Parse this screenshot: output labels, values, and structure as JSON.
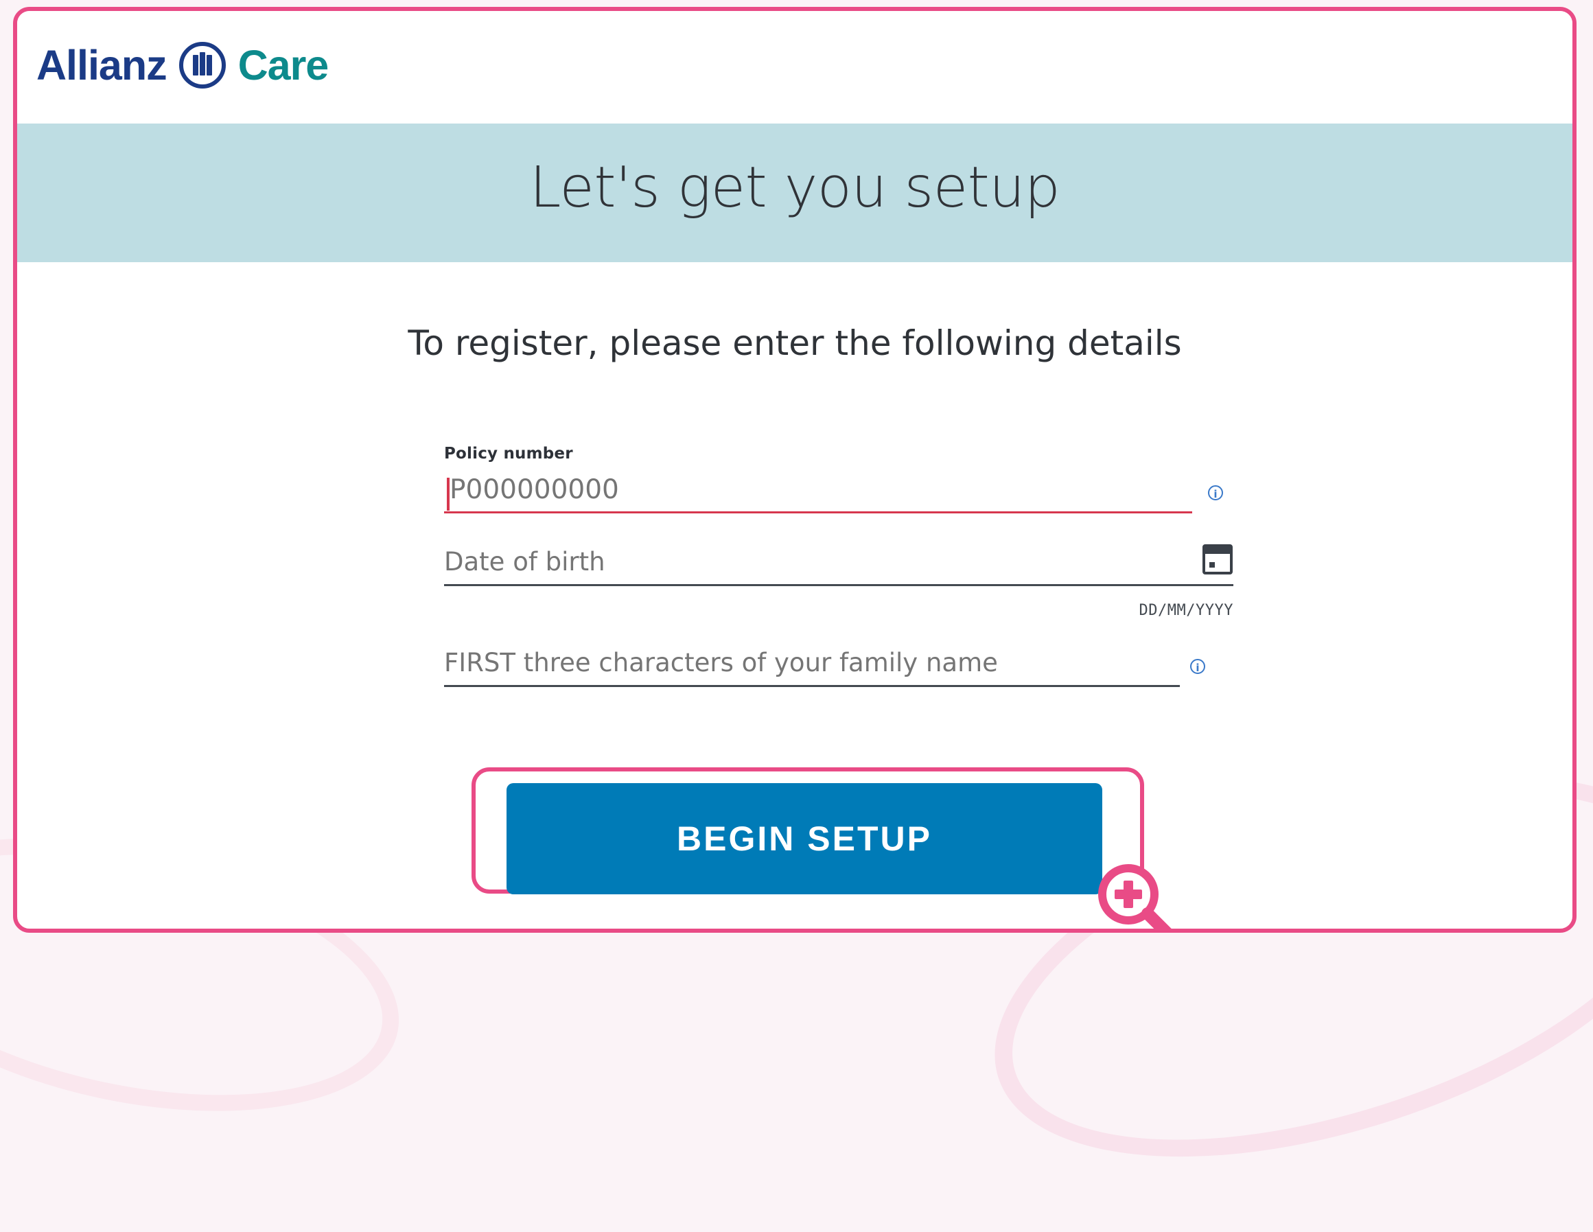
{
  "brand": {
    "primary_word": "Allianz",
    "secondary_word": "Care",
    "logo_icon": "allianz-eagle-icon",
    "primary_color": "#1b3b86",
    "secondary_color": "#0d8a8c"
  },
  "hero": {
    "title": "Let's get you setup",
    "background_color": "#bedde3"
  },
  "form": {
    "subtitle": "To register, please enter the following details",
    "policy_label": "Policy number",
    "policy_placeholder": "P000000000",
    "date_placeholder": "Date of birth",
    "date_hint": "DD/MM/YYYY",
    "family_placeholder": "FIRST three characters of your family name"
  },
  "actions": {
    "begin_setup": "BEGIN SETUP",
    "button_color": "#007bb7"
  },
  "icons": {
    "policy_info": "info-icon",
    "calendar": "calendar-icon",
    "family_info": "info-icon",
    "zoom": "zoom-plus-icon"
  },
  "highlight": {
    "outline_color": "#e94b86"
  }
}
